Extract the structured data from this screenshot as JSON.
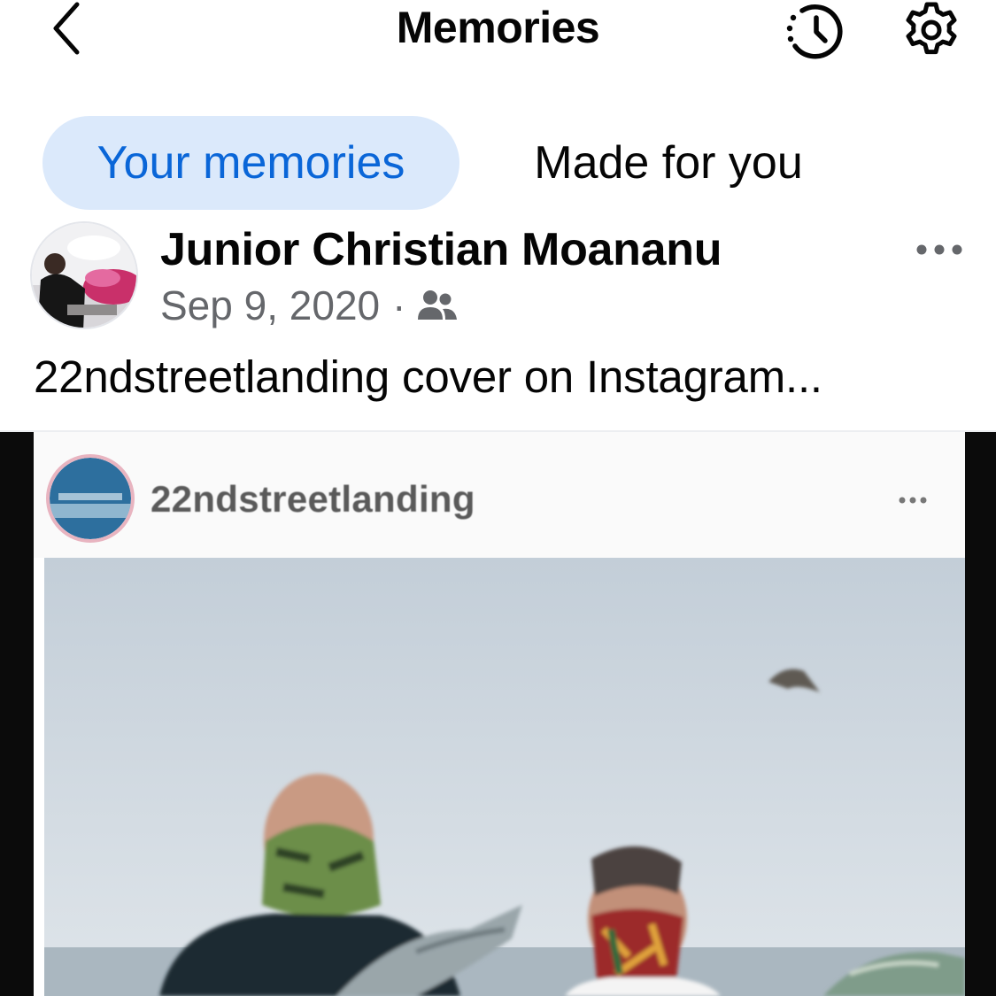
{
  "header": {
    "title": "Memories",
    "icons": {
      "back": "chevron-left-icon",
      "history": "history-icon",
      "settings": "gear-icon"
    }
  },
  "tabs": [
    {
      "label": "Your memories",
      "active": true
    },
    {
      "label": "Made for you",
      "active": false
    }
  ],
  "post": {
    "author": "Junior Christian Moananu",
    "date": "Sep 9, 2020",
    "separator": "·",
    "audience_icon": "friends-icon",
    "caption": "22ndstreetlanding cover on Instagram...",
    "more_icon": "more-horizontal-icon"
  },
  "shared_media": {
    "username": "22ndstreetlanding",
    "more_icon": "more-horizontal-icon"
  },
  "colors": {
    "accent": "#0a66d8",
    "tab_active_bg": "#dbe9fb",
    "meta_text": "#65676b"
  }
}
